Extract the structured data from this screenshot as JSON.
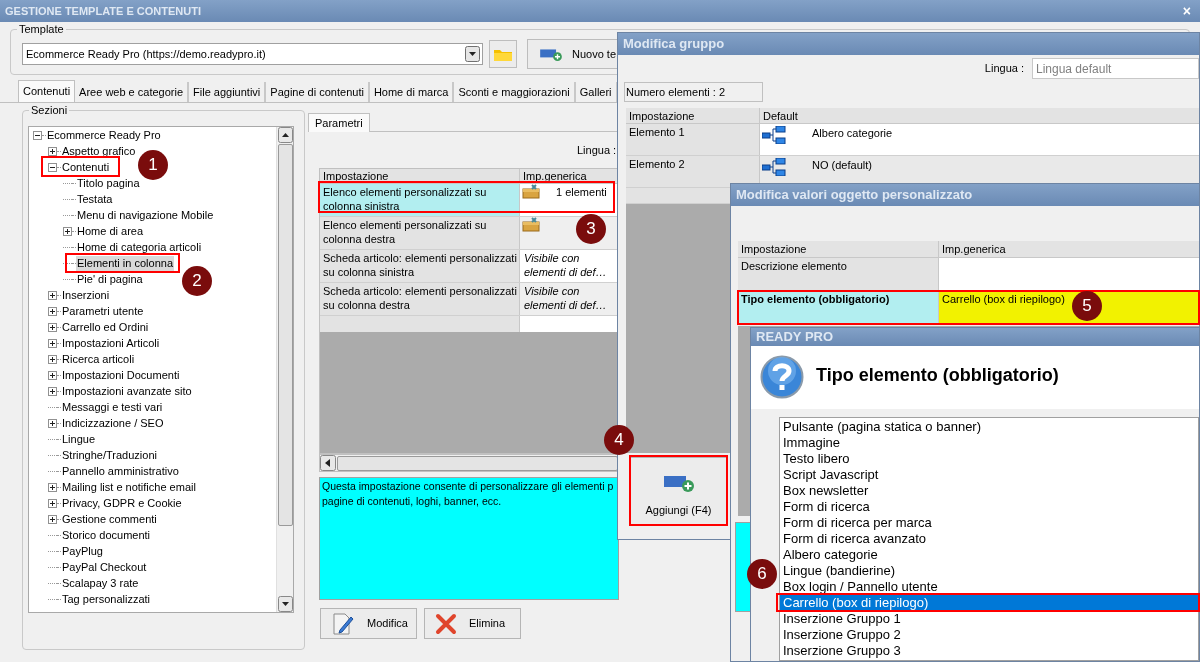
{
  "window": {
    "title": "GESTIONE TEMPLATE E CONTENUTI",
    "close": "×"
  },
  "template": {
    "label": "Template",
    "value": "Ecommerce Ready Pro (https://demo.readypro.it)",
    "new_button": "Nuovo te"
  },
  "tabs": [
    {
      "label": "Contenuti",
      "selected": true
    },
    {
      "label": "Aree web e categorie",
      "selected": false
    },
    {
      "label": "File aggiuntivi",
      "selected": false
    },
    {
      "label": "Pagine di contenuti",
      "selected": false
    },
    {
      "label": "Home di marca",
      "selected": false
    },
    {
      "label": "Sconti e maggiorazioni",
      "selected": false
    },
    {
      "label": "Galleri",
      "selected": false
    }
  ],
  "sections": {
    "label": "Sezioni",
    "tree": [
      {
        "label": "Ecommerce Ready Pro",
        "expanded": true,
        "selected": false,
        "children": [
          {
            "label": "Aspetto grafico",
            "expanded": false,
            "selected": false
          },
          {
            "label": "Contenuti",
            "expanded": true,
            "selected": false,
            "children": [
              {
                "label": "Titolo pagina",
                "selected": false
              },
              {
                "label": "Testata",
                "selected": false
              },
              {
                "label": "Menu di navigazione Mobile",
                "selected": false
              },
              {
                "label": "Home di area",
                "expanded": false,
                "selected": false
              },
              {
                "label": "Home di categoria articoli",
                "selected": false
              },
              {
                "label": "Elementi in colonna",
                "selected": true
              },
              {
                "label": "Pie' di pagina",
                "selected": false
              }
            ]
          },
          {
            "label": "Inserzioni",
            "expanded": false,
            "selected": false
          },
          {
            "label": "Parametri utente",
            "expanded": false,
            "selected": false
          },
          {
            "label": "Carrello ed Ordini",
            "expanded": false,
            "selected": false
          },
          {
            "label": "Impostazioni Articoli",
            "expanded": false,
            "selected": false
          },
          {
            "label": "Ricerca articoli",
            "expanded": false,
            "selected": false
          },
          {
            "label": "Impostazioni Documenti",
            "expanded": false,
            "selected": false
          },
          {
            "label": "Impostazioni avanzate sito",
            "expanded": false,
            "selected": false
          },
          {
            "label": "Messaggi e testi vari",
            "selected": false
          },
          {
            "label": "Indicizzazione / SEO",
            "expanded": false,
            "selected": false
          },
          {
            "label": "Lingue",
            "selected": false
          },
          {
            "label": "Stringhe/Traduzioni",
            "selected": false
          },
          {
            "label": "Pannello amministrativo",
            "selected": false
          },
          {
            "label": "Mailing list e notifiche email",
            "expanded": false,
            "selected": false
          },
          {
            "label": "Privacy, GDPR e Cookie",
            "expanded": false,
            "selected": false
          },
          {
            "label": "Gestione commenti",
            "expanded": false,
            "selected": false
          },
          {
            "label": "Storico documenti",
            "selected": false
          },
          {
            "label": "PayPlug",
            "selected": false
          },
          {
            "label": "PayPal Checkout",
            "selected": false
          },
          {
            "label": "Scalapay 3 rate",
            "selected": false
          },
          {
            "label": "Tag personalizzati",
            "selected": false
          }
        ]
      }
    ]
  },
  "parameters": {
    "tab": "Parametri",
    "language_label": "Lingua :",
    "columns": [
      "Impostazione",
      "Imp.generica"
    ],
    "rows": [
      {
        "setting": "Elenco elementi personalizzati su colonna sinistra",
        "kind": "list",
        "value": "1 elementi",
        "selected": true
      },
      {
        "setting": "Elenco elementi personalizzati su colonna destra",
        "kind": "list",
        "selected": false
      },
      {
        "setting": "Scheda articolo: elementi personalizzati su colonna sinistra",
        "kind": "text",
        "value": "Visibile con elementi di def…",
        "selected": false
      },
      {
        "setting": "Scheda articolo: elementi personalizzati su colonna destra",
        "kind": "text",
        "value": "Visibile con elementi di def…",
        "selected": false
      }
    ],
    "description": [
      "Questa impostazione consente di personalizzare gli elementi p",
      "pagine di contenuti, loghi, banner, ecc."
    ],
    "buttons": [
      {
        "kind": "edit",
        "label": "Modifica"
      },
      {
        "kind": "delete",
        "label": "Elimina"
      }
    ]
  },
  "group_window": {
    "title": "Modifica gruppo",
    "language_label": "Lingua :",
    "language_placeholder": "Lingua default",
    "count": "Numero elementi : 2",
    "columns": [
      "Impostazione",
      "Default"
    ],
    "rows": [
      {
        "setting": "Elemento 1",
        "value": "Albero categorie"
      },
      {
        "setting": "Elemento 2",
        "value": "NO (default)"
      }
    ],
    "add_button": "Aggiungi (F4)"
  },
  "values_window": {
    "title": "Modifica valori oggetto personalizzato",
    "columns": [
      "Impostazione",
      "Imp.generica"
    ],
    "rows": [
      {
        "setting": "Descrizione elemento",
        "selected": false
      },
      {
        "setting": "Tipo elemento (obbligatorio)",
        "value": "Carrello (box di riepilogo)",
        "selected": true
      }
    ]
  },
  "dialog": {
    "title": "READY PRO",
    "heading": "Tipo elemento (obbligatorio)",
    "options": [
      {
        "label": "Pulsante (pagina statica o banner)",
        "selected": false
      },
      {
        "label": "Immagine",
        "selected": false
      },
      {
        "label": "Testo libero",
        "selected": false
      },
      {
        "label": "Script Javascript",
        "selected": false
      },
      {
        "label": "Box newsletter",
        "selected": false
      },
      {
        "label": "Form di ricerca",
        "selected": false
      },
      {
        "label": "Form di ricerca per marca",
        "selected": false
      },
      {
        "label": "Form di ricerca avanzato",
        "selected": false
      },
      {
        "label": "Albero categorie",
        "selected": false
      },
      {
        "label": "Lingue (bandierine)",
        "selected": false
      },
      {
        "label": "Box login / Pannello utente",
        "selected": false
      },
      {
        "label": "Carrello (box di riepilogo)",
        "selected": true
      },
      {
        "label": "Inserzione Gruppo 1",
        "selected": false
      },
      {
        "label": "Inserzione Gruppo 2",
        "selected": false
      },
      {
        "label": "Inserzione Gruppo 3",
        "selected": false
      }
    ]
  },
  "callouts": [
    "1",
    "2",
    "3",
    "4",
    "5",
    "6"
  ]
}
